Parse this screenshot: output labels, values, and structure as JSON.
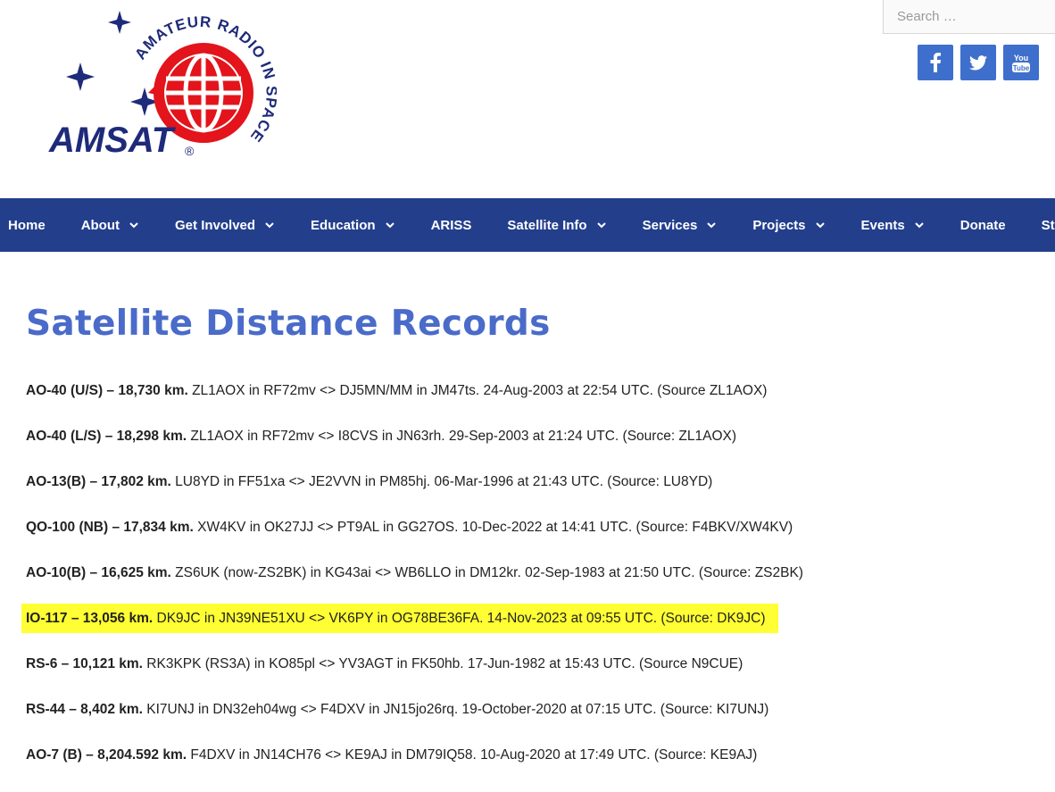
{
  "search": {
    "placeholder": "Search …"
  },
  "logo": {
    "wordmark": "AMSAT",
    "registered": "®",
    "arc_text": "AMATEUR RADIO IN SPACE",
    "colors": {
      "navy": "#1e2a7a",
      "red": "#e3141b"
    }
  },
  "socials": [
    {
      "name": "facebook",
      "glyph": "f"
    },
    {
      "name": "twitter",
      "glyph": "bird"
    },
    {
      "name": "youtube",
      "glyph": "You Tube"
    }
  ],
  "colors": {
    "nav_bg": "#233f8c",
    "title": "#4a6bc9",
    "social_bg": "#3f6fcc",
    "highlight": "#ffff33"
  },
  "nav": {
    "items": [
      {
        "label": "Home",
        "dropdown": false
      },
      {
        "label": "About",
        "dropdown": true
      },
      {
        "label": "Get Involved",
        "dropdown": true
      },
      {
        "label": "Education",
        "dropdown": true
      },
      {
        "label": "ARISS",
        "dropdown": false
      },
      {
        "label": "Satellite Info",
        "dropdown": true
      },
      {
        "label": "Services",
        "dropdown": true
      },
      {
        "label": "Projects",
        "dropdown": true
      },
      {
        "label": "Events",
        "dropdown": true
      },
      {
        "label": "Donate",
        "dropdown": false
      },
      {
        "label": "Store",
        "dropdown": false
      }
    ]
  },
  "page": {
    "title": "Satellite Distance Records"
  },
  "records": [
    {
      "bold": "AO-40 (U/S) – 18,730 km.",
      "text": " ZL1AOX in RF72mv <> DJ5MN/MM in JM47ts. 24-Aug-2003 at 22:54 UTC. (Source ZL1AOX)",
      "highlight": false
    },
    {
      "bold": "AO-40 (L/S) – 18,298 km.",
      "text": " ZL1AOX in RF72mv <> I8CVS in JN63rh. 29-Sep-2003 at 21:24 UTC. (Source: ZL1AOX)",
      "highlight": false
    },
    {
      "bold": "AO-13(B) – 17,802 km.",
      "text": " LU8YD in FF51xa <> JE2VVN in PM85hj. 06-Mar-1996 at 21:43 UTC. (Source: LU8YD)",
      "highlight": false
    },
    {
      "bold": "QO-100 (NB) – 17,834 km.",
      "text": " XW4KV in OK27JJ <> PT9AL in GG27OS. 10-Dec-2022 at 14:41 UTC. (Source: F4BKV/XW4KV)",
      "highlight": false
    },
    {
      "bold": "AO-10(B) – 16,625 km.",
      "text": " ZS6UK (now-ZS2BK) in KG43ai <> WB6LLO in DM12kr. 02-Sep-1983 at 21:50 UTC. (Source: ZS2BK)",
      "highlight": false
    },
    {
      "bold": "IO-117 – 13,056 km.",
      "text": " DK9JC in JN39NE51XU <> VK6PY in OG78BE36FA. 14-Nov-2023 at 09:55 UTC. (Source: DK9JC)",
      "highlight": true
    },
    {
      "bold": "RS-6 – 10,121 km.",
      "text": " RK3KPK (RS3A) in KO85pl <> YV3AGT in FK50hb. 17-Jun-1982 at 15:43 UTC. (Source N9CUE)",
      "highlight": false
    },
    {
      "bold": "RS-44 – 8,402 km.",
      "text": " KI7UNJ in DN32eh04wg <> F4DXV in JN15jo26rq. 19-October-2020 at 07:15 UTC. (Source: KI7UNJ)",
      "highlight": false
    },
    {
      "bold": "AO-7 (B) – 8,204.592 km.",
      "text": " F4DXV in JN14CH76 <> KE9AJ in DM79IQ58. 10-Aug-2020 at 17:49 UTC. (Source: KE9AJ)",
      "highlight": false
    }
  ]
}
